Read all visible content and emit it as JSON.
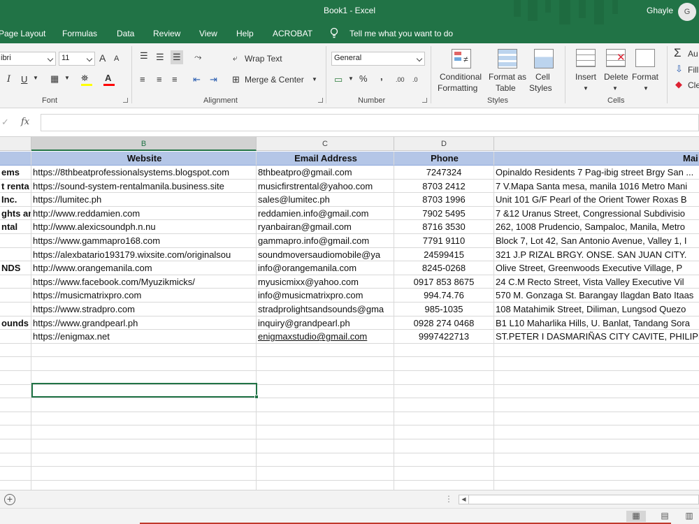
{
  "window": {
    "title": "Book1  -  Excel",
    "user_name": "Ghayle",
    "avatar_initial": "G",
    "accent_color": "#217346"
  },
  "ribbon_tabs": [
    "Page Layout",
    "Formulas",
    "Data",
    "Review",
    "View",
    "Help",
    "ACROBAT",
    "Tell me what you want to do"
  ],
  "font_group": {
    "font_name": "ibri",
    "font_size": "11",
    "grow_label": "A",
    "shrink_label": "A",
    "italic": "I",
    "underline": "U",
    "font_color_label": "A",
    "label": "Font"
  },
  "alignment_group": {
    "wrap_text": "Wrap Text",
    "merge_center": "Merge & Center",
    "label": "Alignment"
  },
  "number_group": {
    "format": "General",
    "percent": "%",
    "comma": ",",
    "inc_decimal": ".00",
    "dec_decimal": ".0",
    "label": "Number"
  },
  "styles_group": {
    "conditional_formatting": [
      "Conditional",
      "Formatting"
    ],
    "format_as_table": [
      "Format as",
      "Table"
    ],
    "cell_styles": [
      "Cell",
      "Styles"
    ],
    "label": "Styles"
  },
  "cells_group": {
    "insert": "Insert",
    "delete": "Delete",
    "format": "Format",
    "label": "Cells"
  },
  "editing_group": {
    "autosum": "Au",
    "fill": "Fill",
    "clear": "Cle"
  },
  "formula_bar": {
    "fx": "fx",
    "value": ""
  },
  "columns": [
    "B",
    "C",
    "D"
  ],
  "table": {
    "headers": [
      "Website",
      "Email Address",
      "Phone",
      "Mai"
    ],
    "rows": [
      [
        "ems",
        "https://8thbeatprofessionalsystems.blogspot.com",
        "8thbeatpro@gmail.com",
        "7247324",
        "Opinaldo Residents 7 Pag-ibig street Brgy San ..."
      ],
      [
        "t  renta",
        "https://sound-system-rentalmanila.business.site",
        "musicfirstrental@yahoo.com",
        "8703 2412",
        "7 V.Mapa Santa mesa, manila 1016 Metro Mani"
      ],
      [
        "Inc.",
        "https://lumitec.ph",
        " sales@lumitec.ph",
        "8703 1996",
        "Unit 101 G/F Pearl of the Orient Tower Roxas B"
      ],
      [
        "ghts an",
        "http://www.reddamien.com",
        "reddamien.info@gmail.com",
        "7902 5495",
        "7 &12 Uranus Street, Congressional Subdivisio"
      ],
      [
        "ntal",
        "http://www.alexicsoundph.n.nu",
        "ryanbairan@gmail.com",
        "8716 3530",
        "262, 1008 Prudencio, Sampaloc, Manila, Metro"
      ],
      [
        "",
        "https://www.gammapro168.com",
        "gammapro.info@gmail.com",
        "7791 9110",
        "Block 7, Lot 42, San Antonio Avenue, Valley 1, I"
      ],
      [
        "",
        "https://alexbatario193179.wixsite.com/originalsou",
        "soundmoversaudiomobile@ya",
        "24599415",
        "321 J.P RIZAL BRGY. ONSE. SAN JUAN CITY."
      ],
      [
        "NDS",
        "http://www.orangemanila.com",
        "info@orangemanila.com",
        "8245-0268",
        "Olive Street, Greenwoods Executive Village, P"
      ],
      [
        "",
        "https://www.facebook.com/Myuzikmicks/",
        "myusicmixx@yahoo.com",
        "0917 853 8675",
        "24 C.M Recto Street, Vista Valley Executive Vil"
      ],
      [
        "",
        "https://musicmatrixpro.com",
        "info@musicmatrixpro.com",
        "994.74.76",
        "570 M. Gonzaga St. Barangay Ilagdan Bato Itaas"
      ],
      [
        "",
        "https://www.stradpro.com",
        "stradprolightsandsounds@gma",
        "985-1035",
        "108 Matahimik Street, Diliman, Lungsod Quezo"
      ],
      [
        "ounds",
        "https://www.grandpearl.ph",
        "inquiry@grandpearl.ph",
        "0928 274 0468",
        "B1 L10 Maharlika Hills, U. Banlat, Tandang Sora"
      ],
      [
        "",
        "https://enigmax.net",
        "enigmaxstudio@gmail.com",
        "9997422713",
        "ST.PETER I DASMARIÑAS CITY CAVITE, PHILIPPI"
      ]
    ]
  },
  "sheet_bar": {
    "add_sheet": "+",
    "dots": "⋮"
  }
}
